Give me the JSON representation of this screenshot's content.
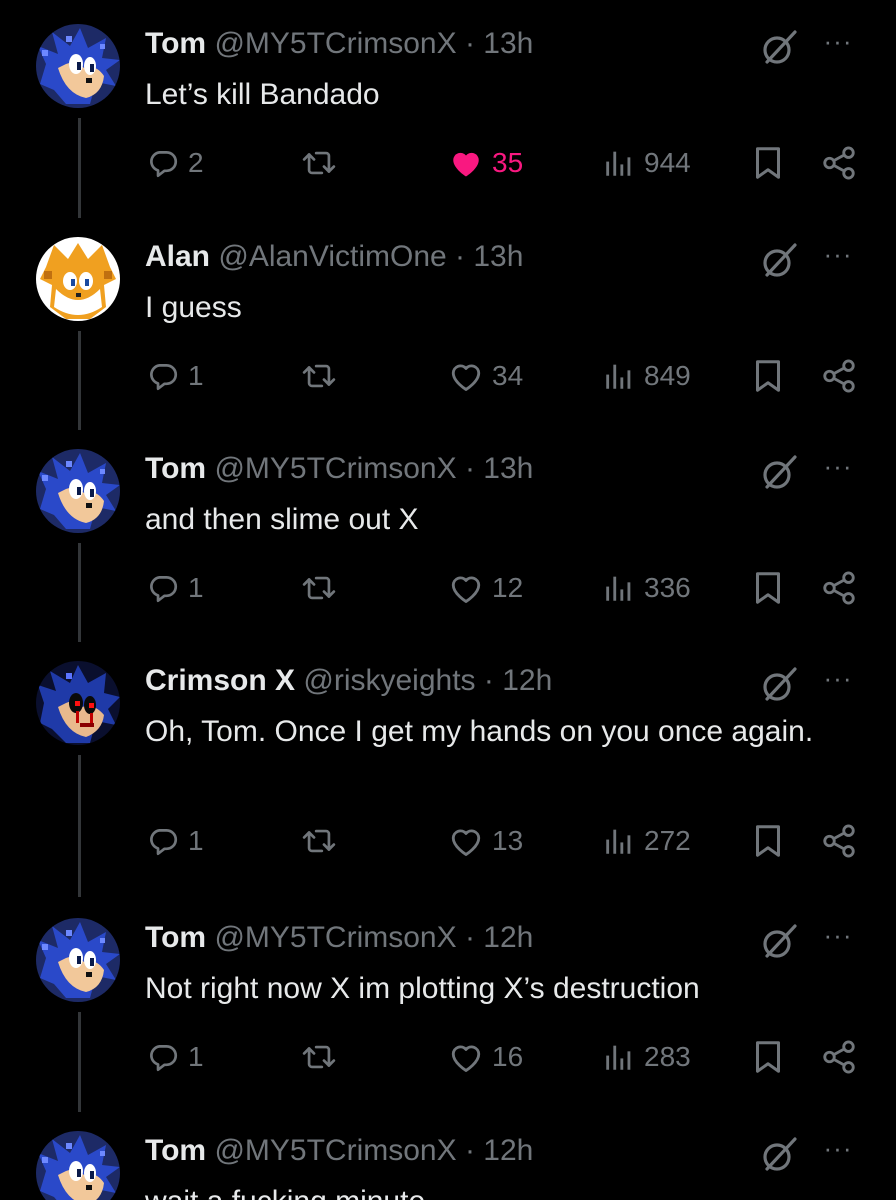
{
  "colors": {
    "background": "#000000",
    "text_primary": "#e7e9ea",
    "text_secondary": "#71767b",
    "like_active": "#f91880",
    "thread_line": "#333639"
  },
  "posts": [
    {
      "avatar": "sonic-pixel-avatar",
      "name": "Tom",
      "handle": "@MY5TCrimsonX",
      "dot": "·",
      "time": "13h",
      "text": "Let’s kill Bandado",
      "replies": "2",
      "retweets": "",
      "likes": "35",
      "liked": true,
      "views": "944"
    },
    {
      "avatar": "tails-pixel-avatar",
      "name": "Alan",
      "handle": "@AlanVictimOne",
      "dot": "·",
      "time": "13h",
      "text": "I guess",
      "replies": "1",
      "retweets": "",
      "likes": "34",
      "liked": false,
      "views": "849"
    },
    {
      "avatar": "sonic-pixel-avatar",
      "name": "Tom",
      "handle": "@MY5TCrimsonX",
      "dot": "·",
      "time": "13h",
      "text": "and then slime out X",
      "replies": "1",
      "retweets": "",
      "likes": "12",
      "liked": false,
      "views": "336"
    },
    {
      "avatar": "sonic-exe-pixel-avatar",
      "name": "Crimson X",
      "handle": "@riskyeights",
      "dot": "·",
      "time": "12h",
      "text": "Oh, Tom. Once I get my hands on you once again.",
      "replies": "1",
      "retweets": "",
      "likes": "13",
      "liked": false,
      "views": "272"
    },
    {
      "avatar": "sonic-pixel-avatar",
      "name": "Tom",
      "handle": "@MY5TCrimsonX",
      "dot": "·",
      "time": "12h",
      "text": "Not right now X im plotting X’s destruction",
      "replies": "1",
      "retweets": "",
      "likes": "16",
      "liked": false,
      "views": "283"
    },
    {
      "avatar": "sonic-pixel-avatar",
      "name": "Tom",
      "handle": "@MY5TCrimsonX",
      "dot": "·",
      "time": "12h",
      "text": "wait a fucking minute",
      "replies": "",
      "retweets": "",
      "likes": "",
      "liked": false,
      "views": ""
    }
  ],
  "icons": {
    "grok": "grok-icon",
    "more": "more-icon",
    "reply": "reply-icon",
    "retweet": "retweet-icon",
    "like": "heart-icon",
    "views": "views-icon",
    "bookmark": "bookmark-icon",
    "share": "share-icon"
  },
  "more_glyph": "···"
}
